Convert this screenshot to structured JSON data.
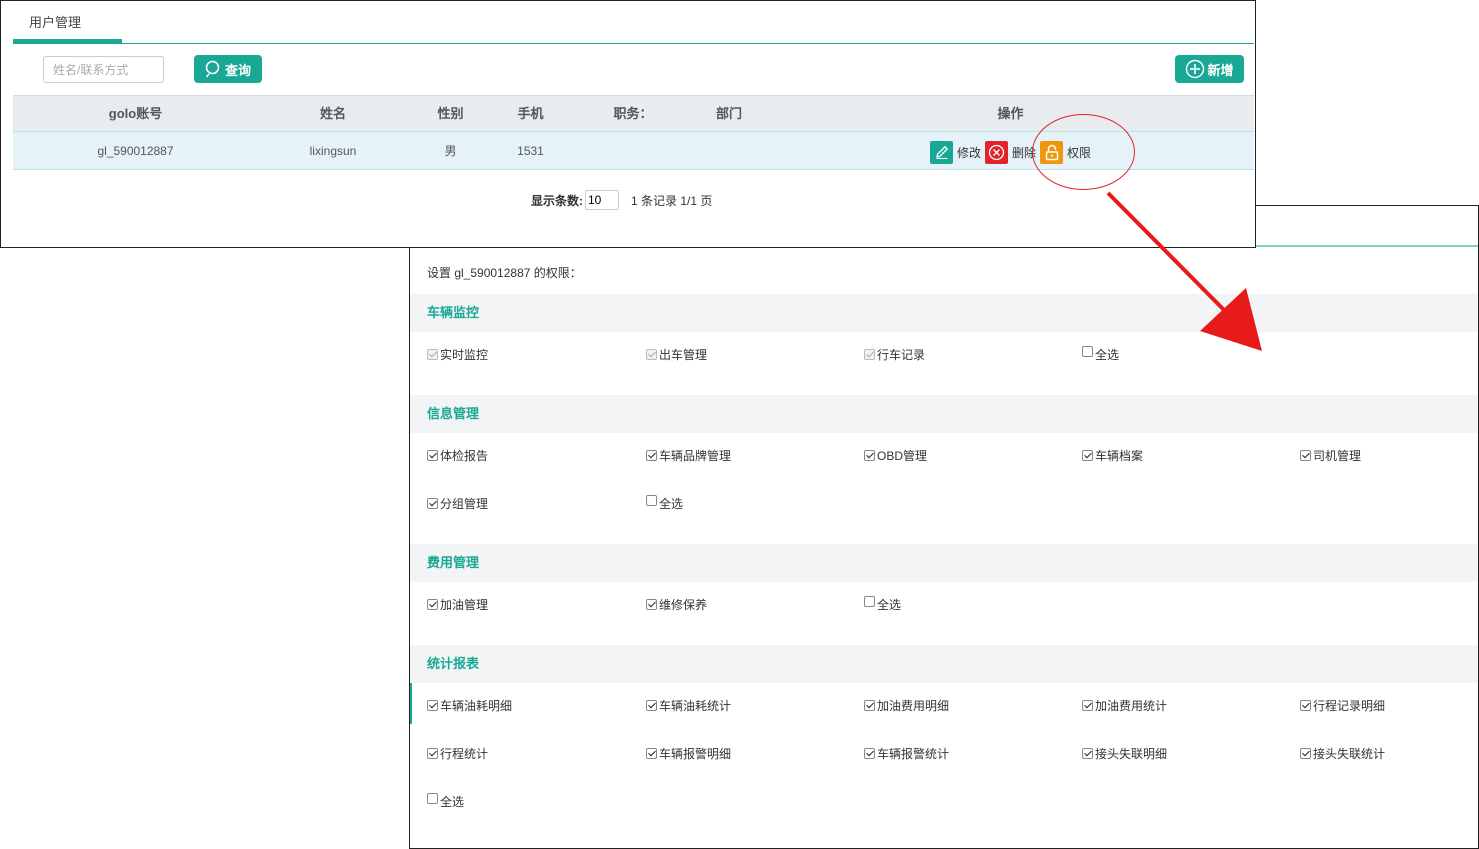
{
  "user_list": {
    "tab_label": "用户管理",
    "search": {
      "placeholder": "姓名/联系方式",
      "button_label": "查询"
    },
    "add_button_label": "新增",
    "columns": [
      "golo账号",
      "姓名",
      "性别",
      "手机",
      "职务：",
      "部门",
      "操作"
    ],
    "rows": [
      {
        "account": "gl_590012887",
        "name": "lixingsun",
        "gender": "男",
        "phone": "1531",
        "title": "",
        "dept": ""
      }
    ],
    "actions": {
      "edit": "修改",
      "delete": "删除",
      "permission": "权限"
    },
    "pager": {
      "label": "显示条数:",
      "page_size": "10",
      "summary": "1 条记录 1/1 页"
    }
  },
  "permissions": {
    "title": "设置 gl_590012887 的权限：",
    "sections": [
      {
        "name": "车辆监控",
        "items": [
          {
            "label": "实时监控",
            "state": "checked-disabled"
          },
          {
            "label": "出车管理",
            "state": "checked-disabled"
          },
          {
            "label": "行车记录",
            "state": "checked-disabled"
          },
          {
            "label": "全选",
            "state": "unchecked"
          }
        ]
      },
      {
        "name": "信息管理",
        "items": [
          {
            "label": "体检报告",
            "state": "checked"
          },
          {
            "label": "车辆品牌管理",
            "state": "checked"
          },
          {
            "label": "OBD管理",
            "state": "checked"
          },
          {
            "label": "车辆档案",
            "state": "checked"
          },
          {
            "label": "司机管理",
            "state": "checked"
          },
          {
            "label": "分组管理",
            "state": "checked"
          },
          {
            "label": "全选",
            "state": "unchecked"
          }
        ]
      },
      {
        "name": "费用管理",
        "items": [
          {
            "label": "加油管理",
            "state": "checked"
          },
          {
            "label": "维修保养",
            "state": "checked"
          },
          {
            "label": "全选",
            "state": "unchecked"
          }
        ]
      },
      {
        "name": "统计报表",
        "items": [
          {
            "label": "车辆油耗明细",
            "state": "checked"
          },
          {
            "label": "车辆油耗统计",
            "state": "checked"
          },
          {
            "label": "加油费用明细",
            "state": "checked"
          },
          {
            "label": "加油费用统计",
            "state": "checked"
          },
          {
            "label": "行程记录明细",
            "state": "checked"
          },
          {
            "label": "行程统计",
            "state": "checked"
          },
          {
            "label": "车辆报警明细",
            "state": "checked"
          },
          {
            "label": "车辆报警统计",
            "state": "checked"
          },
          {
            "label": "接头失联明细",
            "state": "checked"
          },
          {
            "label": "接头失联统计",
            "state": "checked"
          },
          {
            "label": "全选",
            "state": "unchecked"
          }
        ]
      }
    ]
  },
  "colors": {
    "accent": "#1aa896",
    "danger": "#e0242b",
    "warning": "#f0960e",
    "row_highlight": "#e5f3f9"
  },
  "icons": [
    "search-icon",
    "plus-circle-icon",
    "pencil-icon",
    "close-circle-icon",
    "unlock-icon",
    "arrow-icon"
  ]
}
